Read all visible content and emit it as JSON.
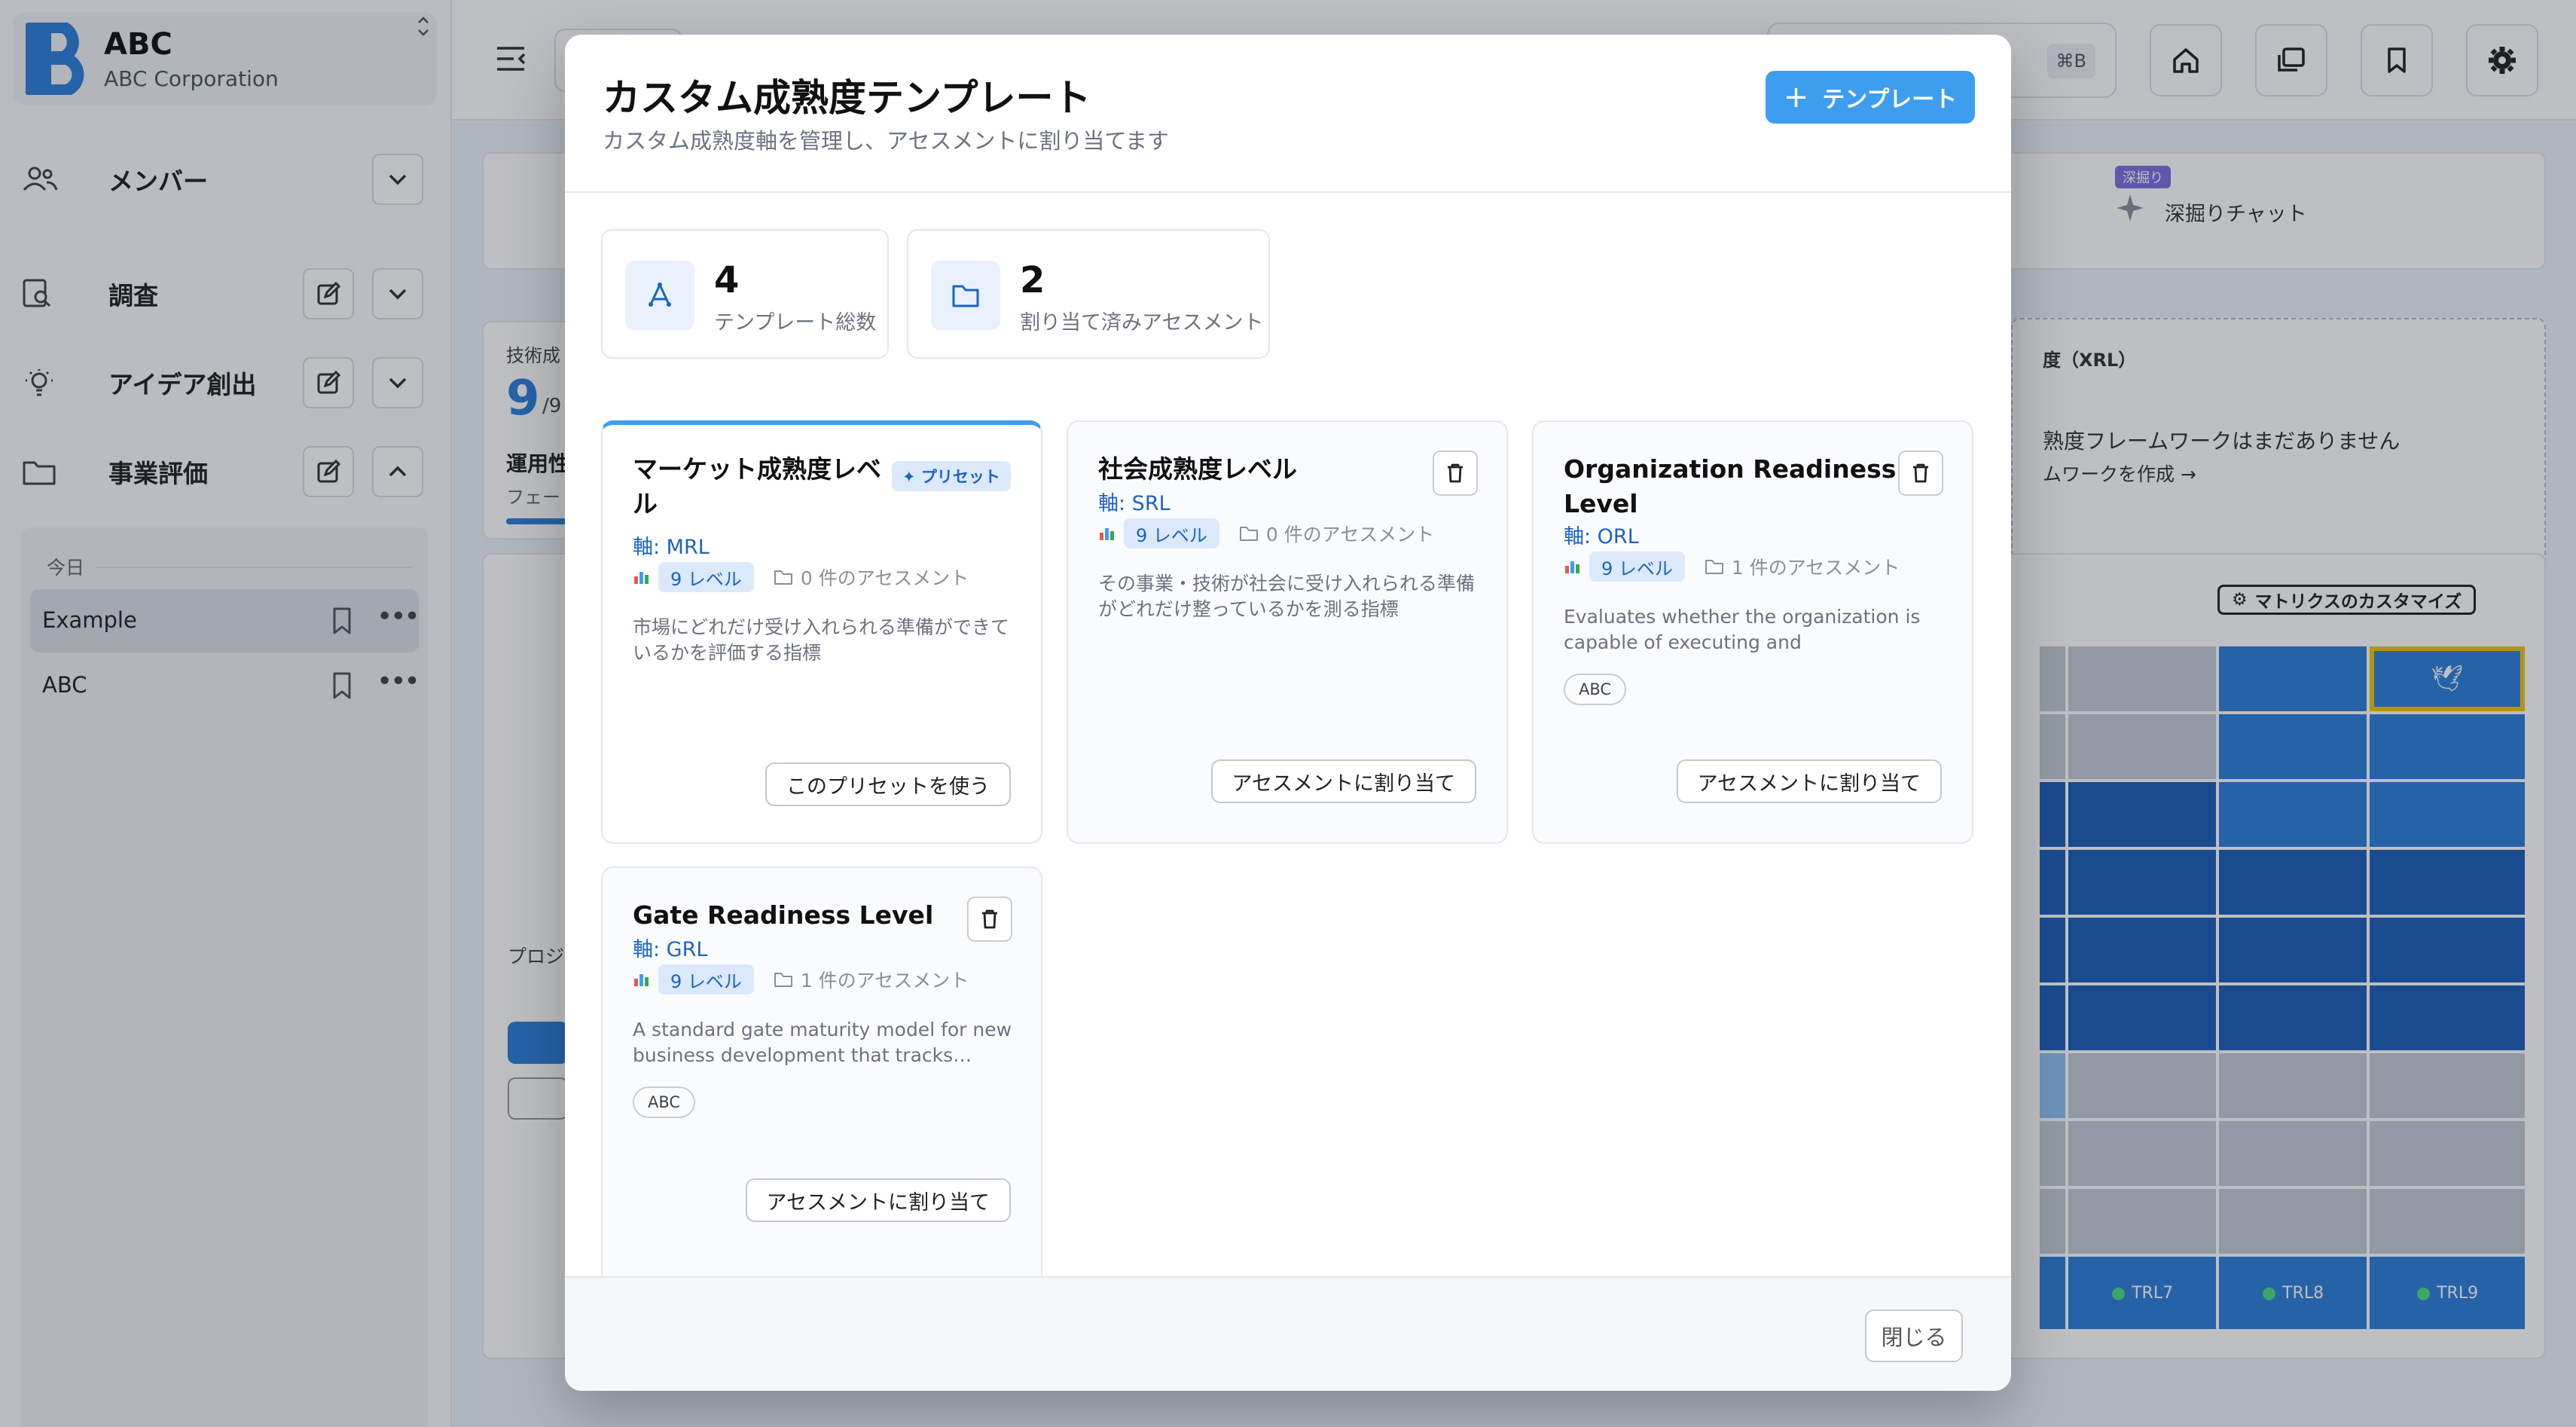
{
  "sidebar": {
    "brand_name": "ABC",
    "brand_sub": "ABC Corporation",
    "nav": [
      {
        "label": "メンバー",
        "icon": "users-icon"
      },
      {
        "label": "調査",
        "icon": "search-document-icon"
      },
      {
        "label": "アイデア創出",
        "icon": "lightbulb-icon"
      },
      {
        "label": "事業評価",
        "icon": "folder-icon"
      }
    ],
    "recent_heading": "今日",
    "recent_items": [
      "Example",
      "ABC"
    ]
  },
  "topbar": {
    "shortcut": "⌘B",
    "icons": [
      "home-icon",
      "layers-icon",
      "bookmark-icon",
      "settings-icon"
    ]
  },
  "background": {
    "chat_badge": "深掘り",
    "chat_label": "深掘りチャット",
    "score_value": "9",
    "score_total": "/9",
    "left_label_1": "技術成",
    "left_label_2": "運用性",
    "left_label_3": "フェー",
    "xrl_title": "度（XRL）",
    "xrl_empty": "熟度フレームワークはまだありません",
    "xrl_create": "ムワークを作成 →",
    "customize_button": "マトリクスのカスタマイズ",
    "pro_label": "プロジ",
    "trl_labels": [
      "TRL7",
      "TRL8",
      "TRL9"
    ],
    "accent_color": "#2f7fd8"
  },
  "modal": {
    "title": "カスタム成熟度テンプレート",
    "subtitle": "カスタム成熟度軸を管理し、アセスメントに割り当てます",
    "add_button": "テンプレート",
    "stats": [
      {
        "value": "4",
        "label": "テンプレート総数",
        "icon": "sparkle-grid-icon"
      },
      {
        "value": "2",
        "label": "割り当て済みアセスメント",
        "icon": "folder-icon"
      }
    ],
    "cards": [
      {
        "title": "マーケット成熟度レベル",
        "axis": "軸: MRL",
        "levels": "9 レベル",
        "assessments": "0 件のアセスメント",
        "description": "市場にどれだけ受け入れられる準備ができているかを評価する指標",
        "badge": "✦ プリセット",
        "tag": "",
        "button": "このプリセットを使う"
      },
      {
        "title": "社会成熟度レベル",
        "axis": "軸: SRL",
        "levels": "9 レベル",
        "assessments": "0 件のアセスメント",
        "description": "その事業・技術が社会に受け入れられる準備がどれだけ整っているかを測る指標",
        "badge": "",
        "tag": "",
        "button": "アセスメントに割り当て"
      },
      {
        "title": "Organization Readiness Level",
        "axis": "軸: ORL",
        "levels": "9 レベル",
        "assessments": "1 件のアセスメント",
        "description": "Evaluates whether the organization is capable of executing and continuously…",
        "badge": "",
        "tag": "ABC",
        "button": "アセスメントに割り当て"
      },
      {
        "title": "Gate Readiness Level",
        "axis": "軸: GRL",
        "levels": "9 レベル",
        "assessments": "1 件のアセスメント",
        "description": "A standard gate maturity model for new business development that tracks…",
        "badge": "",
        "tag": "ABC",
        "button": "アセスメントに割り当て"
      }
    ],
    "close_button": "閉じる",
    "primary_color": "#3d9eef"
  }
}
